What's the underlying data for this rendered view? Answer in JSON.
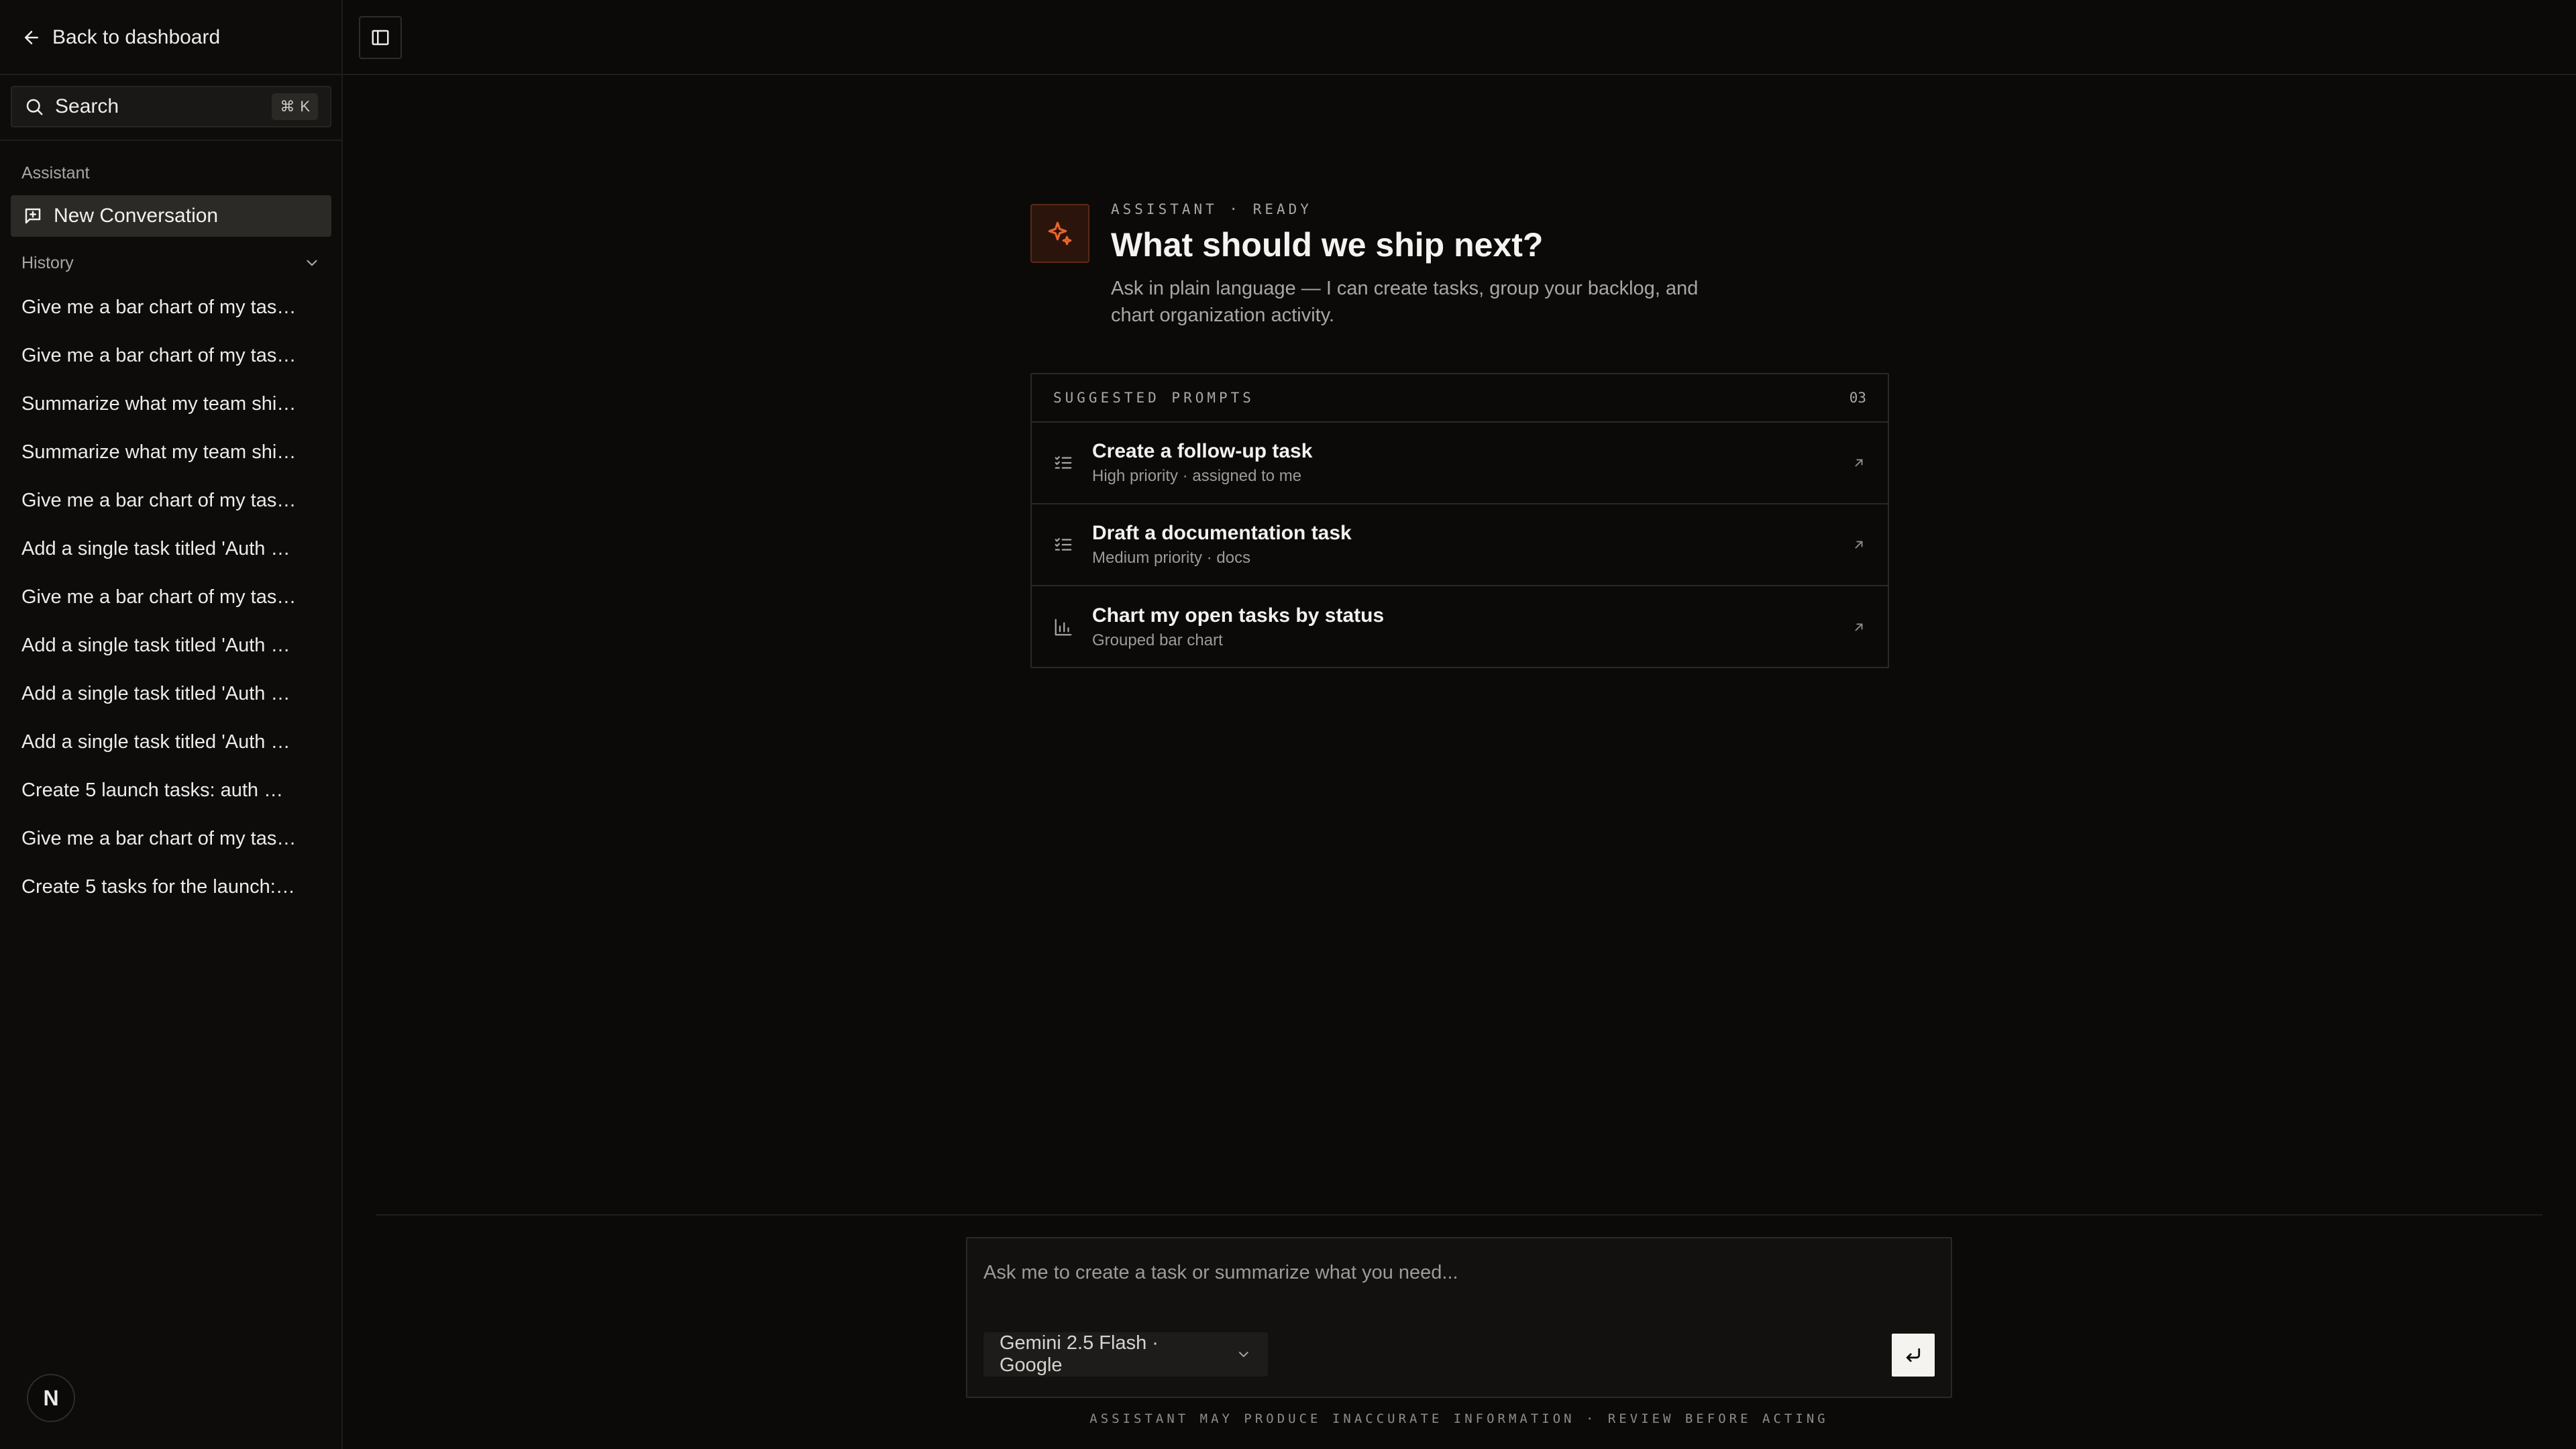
{
  "sidebar": {
    "back_label": "Back to dashboard",
    "search": {
      "label": "Search",
      "shortcut_key": "⌘",
      "shortcut_letter": "K"
    },
    "assistant_section": "Assistant",
    "new_conversation": "New Conversation",
    "history_label": "History",
    "history": [
      "Give me a bar chart of my tas…",
      "Give me a bar chart of my tas…",
      "Summarize what my team shi…",
      "Summarize what my team shi…",
      "Give me a bar chart of my tas…",
      "Add a single task titled 'Auth …",
      "Give me a bar chart of my tas…",
      "Add a single task titled 'Auth …",
      "Add a single task titled 'Auth …",
      "Add a single task titled 'Auth …",
      "Create 5 launch tasks: auth …",
      "Give me a bar chart of my tas…",
      "Create 5 tasks for the launch:…"
    ],
    "avatar_letter": "N"
  },
  "hero": {
    "eyebrow": "ASSISTANT · READY",
    "title": "What should we ship next?",
    "subtitle": "Ask in plain language — I can create tasks, group your backlog, and chart organization activity."
  },
  "prompts": {
    "header": "SUGGESTED PROMPTS",
    "count": "03",
    "items": [
      {
        "title": "Create a follow-up task",
        "sub": "High priority · assigned to me",
        "icon": "checklist-icon"
      },
      {
        "title": "Draft a documentation task",
        "sub": "Medium priority · docs",
        "icon": "checklist-icon"
      },
      {
        "title": "Chart my open tasks by status",
        "sub": "Grouped bar chart",
        "icon": "bar-chart-icon"
      }
    ]
  },
  "composer": {
    "placeholder": "Ask me to create a task or summarize what you need...",
    "model": "Gemini 2.5 Flash · Google",
    "disclaimer": "ASSISTANT MAY PRODUCE INACCURATE INFORMATION · REVIEW BEFORE ACTING"
  },
  "colors": {
    "background": "#0b0a09",
    "accent": "#e8642c",
    "text": "#ecebe8",
    "muted": "#a9a7a2"
  }
}
